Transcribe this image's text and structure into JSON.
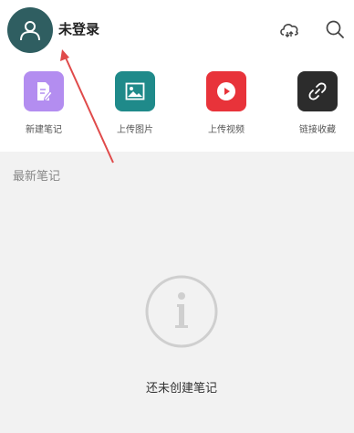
{
  "header": {
    "username": "未登录",
    "avatar_icon": "user-icon",
    "cloud_icon": "cloud-sync-icon",
    "search_icon": "search-icon"
  },
  "actions": [
    {
      "label": "新建笔记",
      "icon": "note-edit-icon",
      "color": "#b38df0"
    },
    {
      "label": "上传图片",
      "icon": "image-icon",
      "color": "#1f8a8a"
    },
    {
      "label": "上传视频",
      "icon": "play-icon",
      "color": "#e8333a"
    },
    {
      "label": "链接收藏",
      "icon": "link-icon",
      "color": "#2c2c2c"
    }
  ],
  "notes": {
    "title": "最新笔记",
    "empty_icon": "info-icon",
    "empty_text": "还未创建笔记"
  },
  "colors": {
    "avatar_bg": "#2f5e61",
    "section_bg": "#f2f2f2",
    "annotation_arrow": "#e04a4a"
  }
}
